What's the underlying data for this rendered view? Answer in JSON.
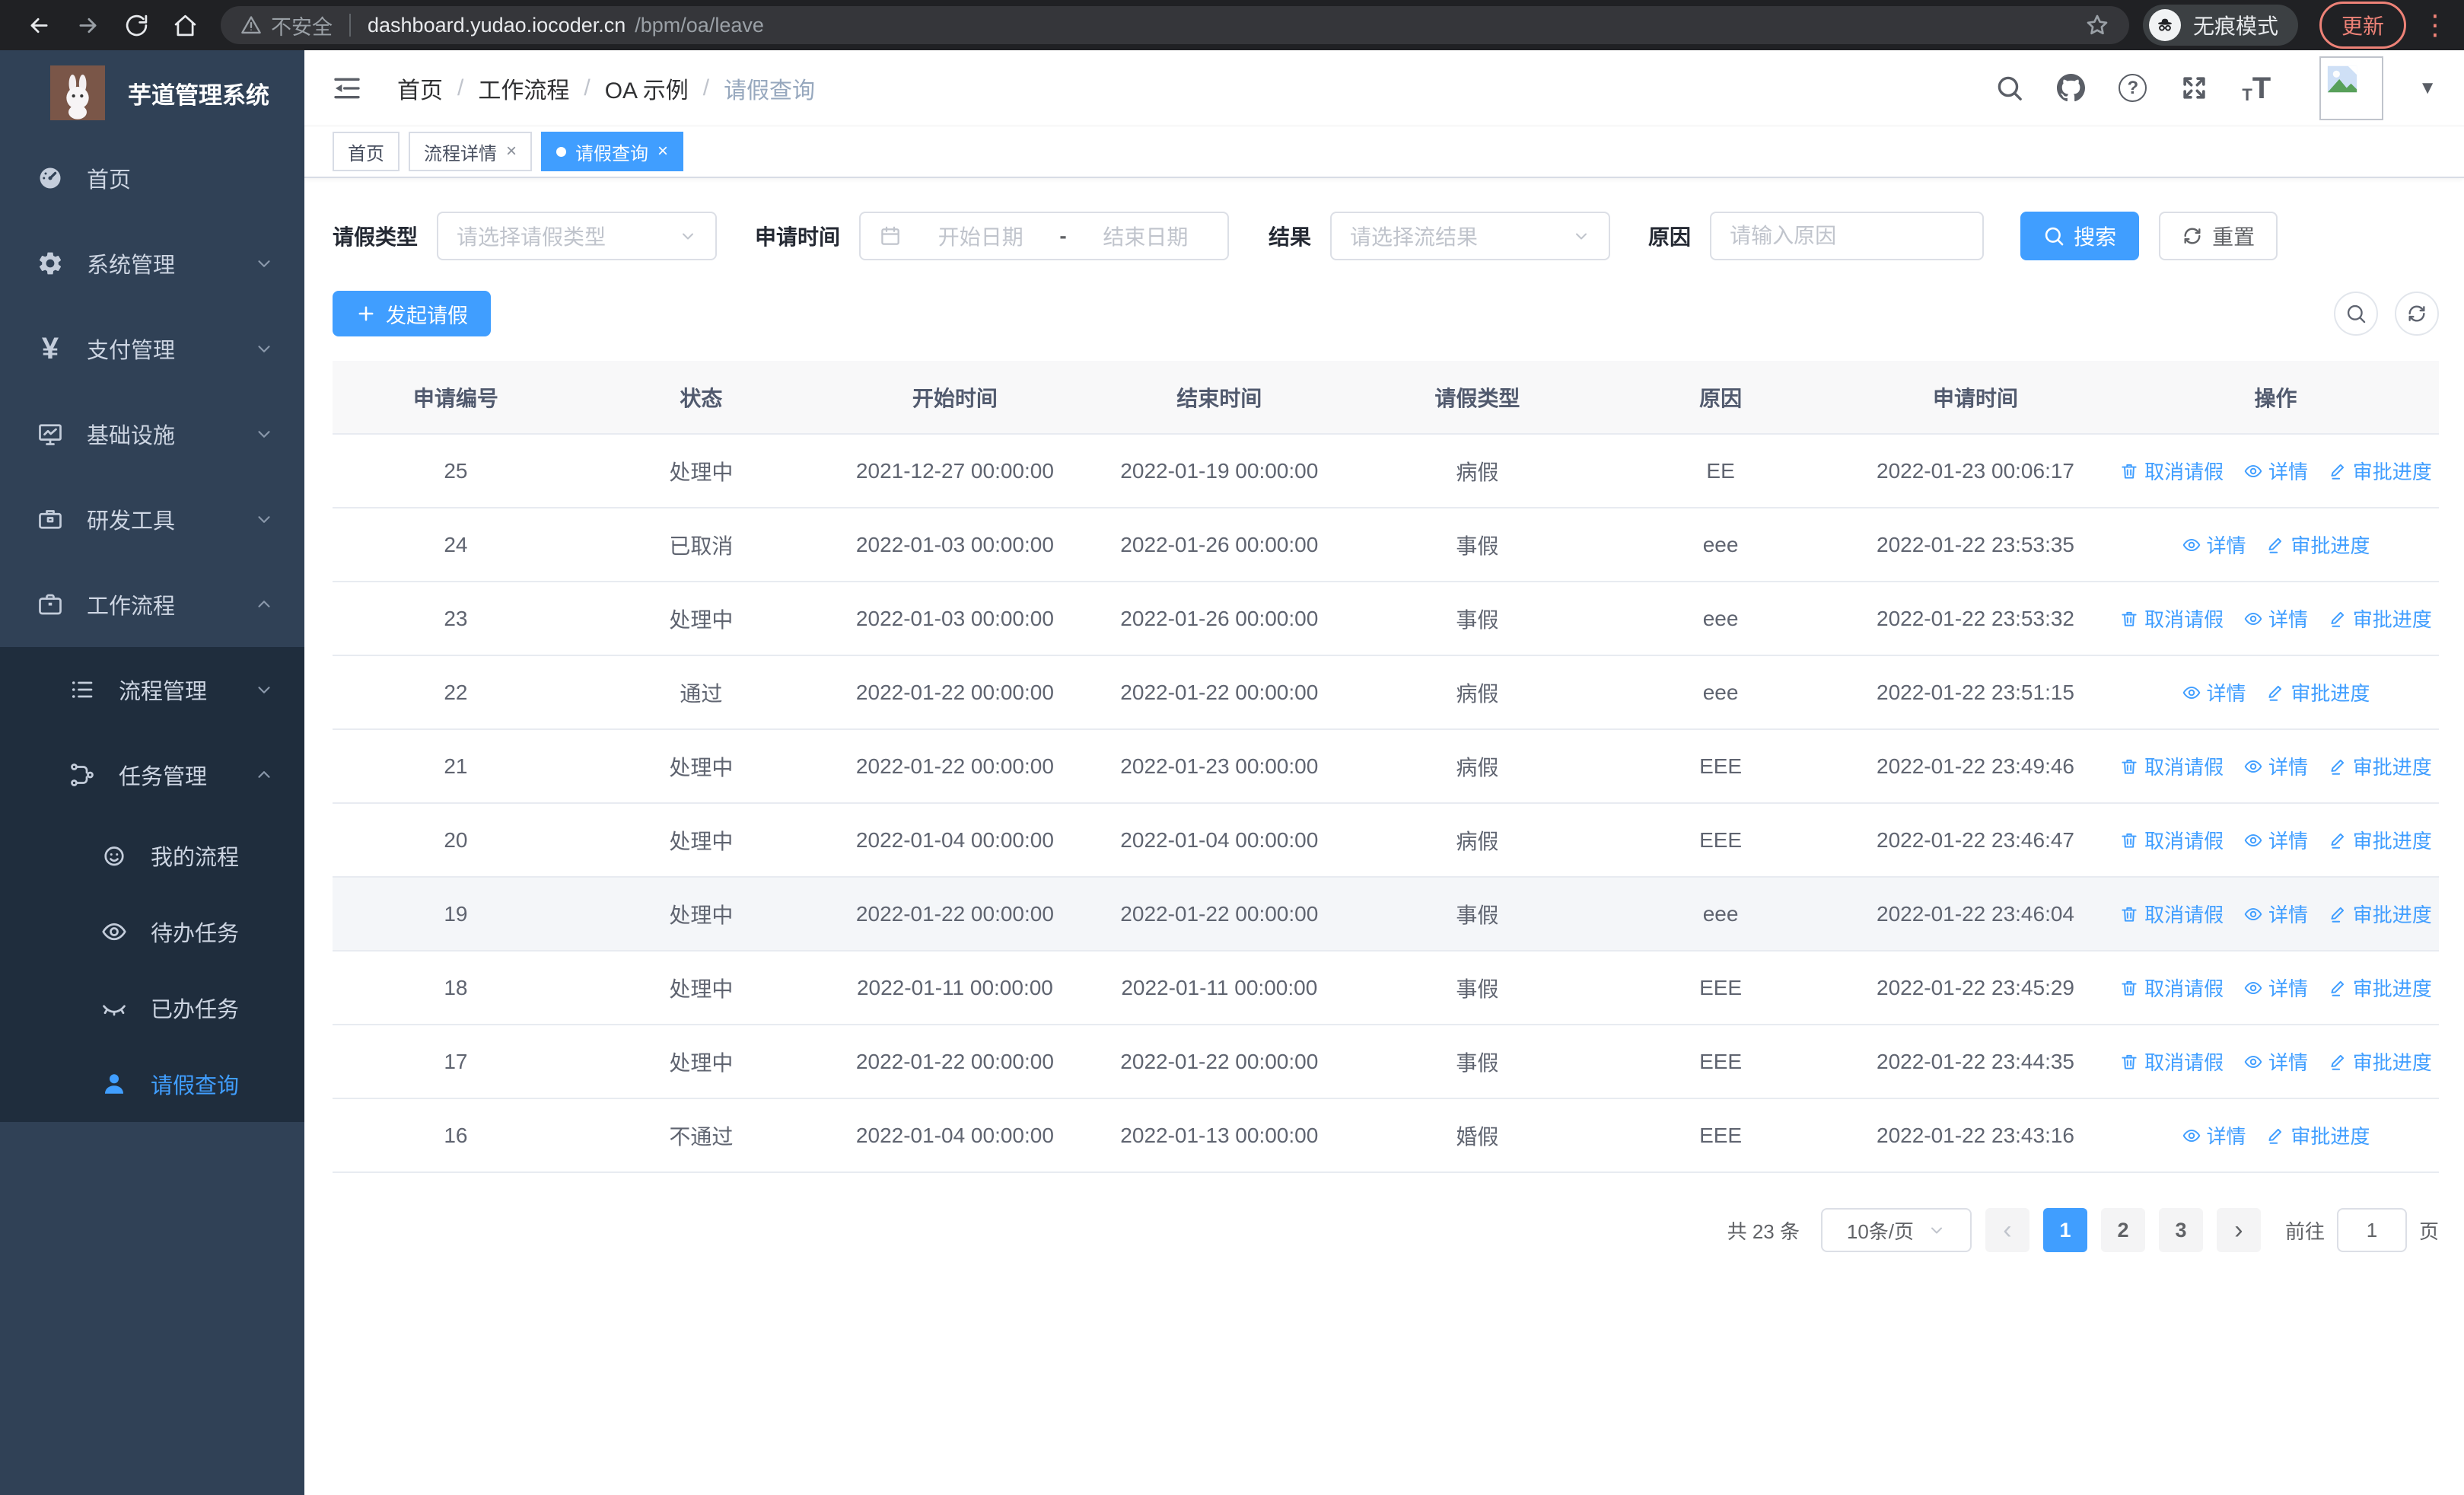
{
  "colors": {
    "accent": "#409eff",
    "sidebar_bg": "#304156",
    "submenu_bg": "#1f2d3d",
    "chrome_bg": "#202124",
    "update_red": "#ee8277",
    "table_header_bg": "#f8f8f9"
  },
  "glyphs": {
    "close": "×",
    "active_dot": "●",
    "caret_down": "▼",
    "menu_dots": "⋮",
    "prev": "‹",
    "next": "›",
    "question": "?",
    "yen": "¥",
    "t_small": "T",
    "t_big": "T"
  },
  "browser": {
    "security_label": "不安全",
    "url_host": "dashboard.yudao.iocoder.cn",
    "url_path": "/bpm/oa/leave",
    "incognito_label": "无痕模式",
    "update_label": "更新"
  },
  "sidebar": {
    "title": "芋道管理系统",
    "items": [
      {
        "label": "首页"
      },
      {
        "label": "系统管理"
      },
      {
        "label": "支付管理"
      },
      {
        "label": "基础设施"
      },
      {
        "label": "研发工具"
      },
      {
        "label": "工作流程"
      },
      {
        "label": "流程管理"
      },
      {
        "label": "任务管理"
      },
      {
        "label": "我的流程"
      },
      {
        "label": "待办任务"
      },
      {
        "label": "已办任务"
      },
      {
        "label": "请假查询"
      }
    ]
  },
  "breadcrumb": {
    "items": [
      "首页",
      "工作流程",
      "OA 示例",
      "请假查询"
    ],
    "separator": "/"
  },
  "tags": [
    {
      "label": "首页"
    },
    {
      "label": "流程详情"
    },
    {
      "label": "请假查询"
    }
  ],
  "filters": {
    "leave_type_label": "请假类型",
    "leave_type_placeholder": "请选择请假类型",
    "apply_time_label": "申请时间",
    "date_start_placeholder": "开始日期",
    "date_separator": "-",
    "date_end_placeholder": "结束日期",
    "result_label": "结果",
    "result_placeholder": "请选择流结果",
    "reason_label": "原因",
    "reason_placeholder": "请输入原因",
    "search_label": "搜索",
    "reset_label": "重置"
  },
  "toolbar": {
    "create_label": "发起请假"
  },
  "table": {
    "columns": [
      "申请编号",
      "状态",
      "开始时间",
      "结束时间",
      "请假类型",
      "原因",
      "申请时间",
      "操作"
    ],
    "actions": {
      "cancel": "取消请假",
      "detail": "详情",
      "progress": "审批进度"
    },
    "rows": [
      {
        "id": "25",
        "status": "处理中",
        "start": "2021-12-27 00:00:00",
        "end": "2022-01-19 00:00:00",
        "type": "病假",
        "reason": "EE",
        "applied": "2022-01-23 00:06:17",
        "can_cancel": true,
        "highlight": false
      },
      {
        "id": "24",
        "status": "已取消",
        "start": "2022-01-03 00:00:00",
        "end": "2022-01-26 00:00:00",
        "type": "事假",
        "reason": "eee",
        "applied": "2022-01-22 23:53:35",
        "can_cancel": false,
        "highlight": false
      },
      {
        "id": "23",
        "status": "处理中",
        "start": "2022-01-03 00:00:00",
        "end": "2022-01-26 00:00:00",
        "type": "事假",
        "reason": "eee",
        "applied": "2022-01-22 23:53:32",
        "can_cancel": true,
        "highlight": false
      },
      {
        "id": "22",
        "status": "通过",
        "start": "2022-01-22 00:00:00",
        "end": "2022-01-22 00:00:00",
        "type": "病假",
        "reason": "eee",
        "applied": "2022-01-22 23:51:15",
        "can_cancel": false,
        "highlight": false
      },
      {
        "id": "21",
        "status": "处理中",
        "start": "2022-01-22 00:00:00",
        "end": "2022-01-23 00:00:00",
        "type": "病假",
        "reason": "EEE",
        "applied": "2022-01-22 23:49:46",
        "can_cancel": true,
        "highlight": false
      },
      {
        "id": "20",
        "status": "处理中",
        "start": "2022-01-04 00:00:00",
        "end": "2022-01-04 00:00:00",
        "type": "病假",
        "reason": "EEE",
        "applied": "2022-01-22 23:46:47",
        "can_cancel": true,
        "highlight": false
      },
      {
        "id": "19",
        "status": "处理中",
        "start": "2022-01-22 00:00:00",
        "end": "2022-01-22 00:00:00",
        "type": "事假",
        "reason": "eee",
        "applied": "2022-01-22 23:46:04",
        "can_cancel": true,
        "highlight": true
      },
      {
        "id": "18",
        "status": "处理中",
        "start": "2022-01-11 00:00:00",
        "end": "2022-01-11 00:00:00",
        "type": "事假",
        "reason": "EEE",
        "applied": "2022-01-22 23:45:29",
        "can_cancel": true,
        "highlight": false
      },
      {
        "id": "17",
        "status": "处理中",
        "start": "2022-01-22 00:00:00",
        "end": "2022-01-22 00:00:00",
        "type": "事假",
        "reason": "EEE",
        "applied": "2022-01-22 23:44:35",
        "can_cancel": true,
        "highlight": false
      },
      {
        "id": "16",
        "status": "不通过",
        "start": "2022-01-04 00:00:00",
        "end": "2022-01-13 00:00:00",
        "type": "婚假",
        "reason": "EEE",
        "applied": "2022-01-22 23:43:16",
        "can_cancel": false,
        "highlight": false
      }
    ]
  },
  "pagination": {
    "total_label": "共 23 条",
    "page_size_label": "10条/页",
    "pages": [
      "1",
      "2",
      "3"
    ],
    "active_page": "1",
    "goto_label": "前往",
    "goto_value": "1",
    "unit_label": "页"
  }
}
